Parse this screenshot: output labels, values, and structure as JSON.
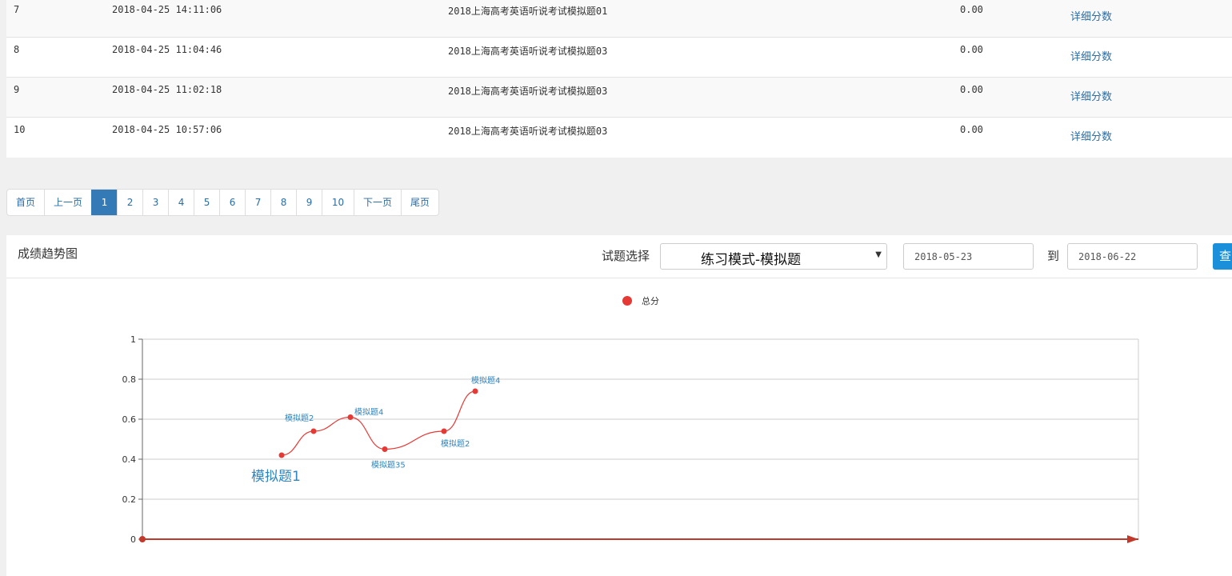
{
  "table": {
    "rows": [
      {
        "no": "7",
        "time": "2018-04-25 14:11:06",
        "paper": "2018上海高考英语听说考试模拟题01",
        "score": "0.00",
        "link": "详细分数"
      },
      {
        "no": "8",
        "time": "2018-04-25 11:04:46",
        "paper": "2018上海高考英语听说考试模拟题03",
        "score": "0.00",
        "link": "详细分数"
      },
      {
        "no": "9",
        "time": "2018-04-25 11:02:18",
        "paper": "2018上海高考英语听说考试模拟题03",
        "score": "0.00",
        "link": "详细分数"
      },
      {
        "no": "10",
        "time": "2018-04-25 10:57:06",
        "paper": "2018上海高考英语听说考试模拟题03",
        "score": "0.00",
        "link": "详细分数"
      }
    ]
  },
  "pager": {
    "first": "首页",
    "prev": "上一页",
    "pages": [
      "1",
      "2",
      "3",
      "4",
      "5",
      "6",
      "7",
      "8",
      "9",
      "10"
    ],
    "current": "1",
    "next": "下一页",
    "last": "尾页"
  },
  "trend": {
    "title": "成绩趋势图",
    "select_label": "试题选择",
    "select_value": "练习模式-模拟题",
    "date_from": "2018-05-23",
    "to_label": "到",
    "date_to": "2018-06-22",
    "query_label": "查"
  },
  "colors": {
    "series": "#e53935",
    "accent": "#337ab7",
    "link": "#2b6da5"
  },
  "chart_data": {
    "type": "line",
    "legend": [
      "总分"
    ],
    "legend_position": "top-center",
    "ylim": [
      0,
      1
    ],
    "yticks": [
      "0",
      "0.2",
      "0.4",
      "0.6",
      "0.8",
      "1"
    ],
    "grid": true,
    "series": [
      {
        "name": "总分",
        "points": [
          {
            "label": "模拟题1",
            "y": 0.42
          },
          {
            "label": "模拟题2",
            "y": 0.54
          },
          {
            "label": "模拟题4",
            "y": 0.61
          },
          {
            "label": "模拟题35",
            "y": 0.45
          },
          {
            "label": "模拟题2",
            "y": 0.54
          },
          {
            "label": "模拟题4",
            "y": 0.74
          }
        ]
      }
    ]
  }
}
